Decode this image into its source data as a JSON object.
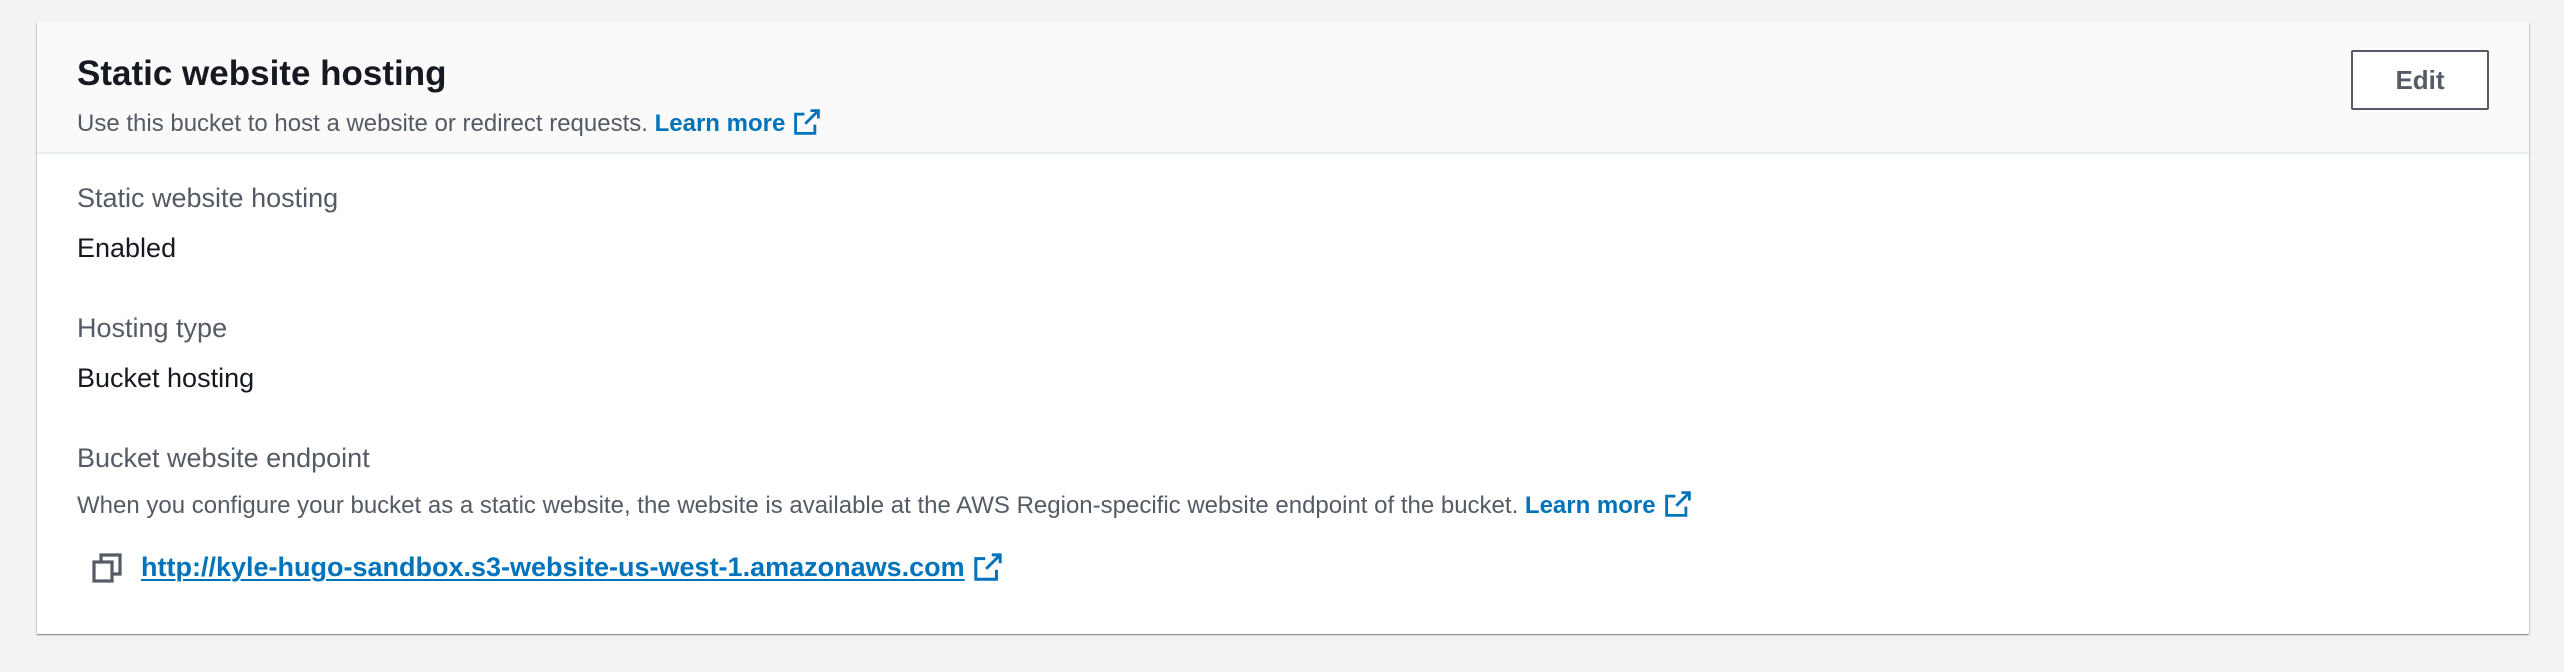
{
  "panel": {
    "title": "Static website hosting",
    "description": "Use this bucket to host a website or redirect requests.",
    "learn_more_label": "Learn more",
    "edit_label": "Edit"
  },
  "fields": {
    "hosting": {
      "label": "Static website hosting",
      "value": "Enabled"
    },
    "hosting_type": {
      "label": "Hosting type",
      "value": "Bucket hosting"
    },
    "endpoint": {
      "label": "Bucket website endpoint",
      "description": "When you configure your bucket as a static website, the website is available at the AWS Region-specific website endpoint of the bucket.",
      "learn_more_label": "Learn more",
      "url": "http://kyle-hugo-sandbox.s3-website-us-west-1.amazonaws.com"
    }
  },
  "icons": {
    "external_link": "external-link-icon",
    "copy": "copy-icon"
  },
  "colors": {
    "link": "#0073bb",
    "text": "#16191f",
    "secondary_text": "#545b64",
    "page_background": "#f2f3f3",
    "header_background": "#fafafa"
  }
}
